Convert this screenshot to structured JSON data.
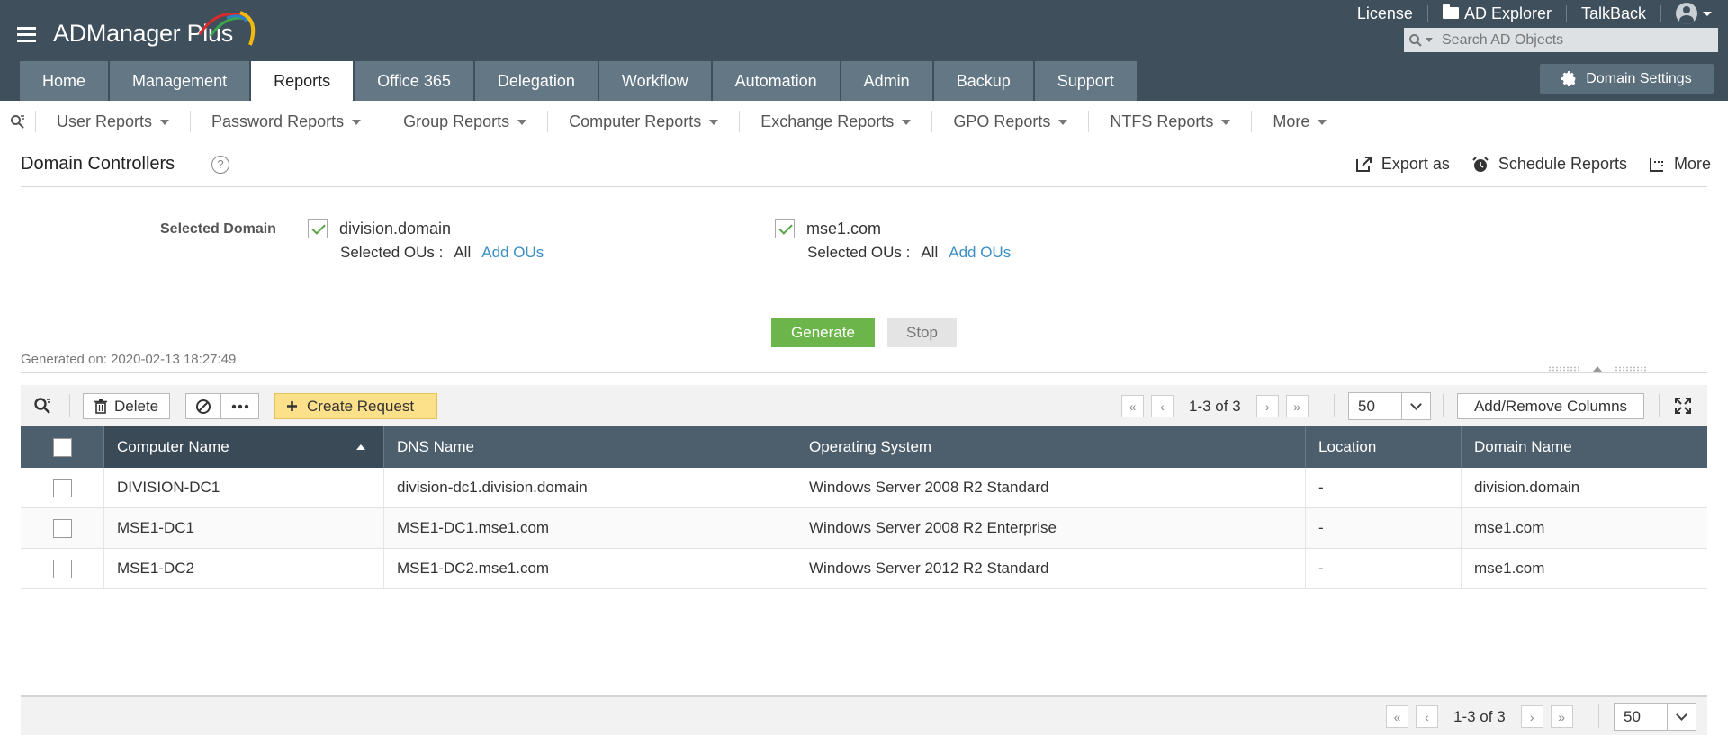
{
  "app": {
    "name": "ADManager Plus",
    "top_links": {
      "license": "License",
      "ad_explorer": "AD Explorer",
      "talkback": "TalkBack"
    },
    "search_placeholder": "Search AD Objects",
    "domain_settings": "Domain Settings",
    "colors": {
      "header": "#3f4f5c",
      "tab": "#637785",
      "accent_green": "#6cb54b",
      "link": "#3b8ec4",
      "create_btn": "#fde18a"
    }
  },
  "tabs": [
    {
      "label": "Home"
    },
    {
      "label": "Management"
    },
    {
      "label": "Reports",
      "active": true
    },
    {
      "label": "Office 365"
    },
    {
      "label": "Delegation"
    },
    {
      "label": "Workflow"
    },
    {
      "label": "Automation"
    },
    {
      "label": "Admin"
    },
    {
      "label": "Backup"
    },
    {
      "label": "Support"
    }
  ],
  "subnav": [
    {
      "label": "User Reports"
    },
    {
      "label": "Password Reports"
    },
    {
      "label": "Group Reports"
    },
    {
      "label": "Computer Reports"
    },
    {
      "label": "Exchange Reports"
    },
    {
      "label": "GPO Reports"
    },
    {
      "label": "NTFS Reports"
    },
    {
      "label": "More"
    }
  ],
  "page": {
    "title": "Domain Controllers",
    "help": "?",
    "actions": {
      "export": "Export as",
      "schedule": "Schedule Reports",
      "more": "More"
    }
  },
  "selection": {
    "label": "Selected Domain",
    "domains": [
      {
        "name": "division.domain",
        "checked": true,
        "ous_label": "Selected OUs :",
        "ous_value": "All",
        "add_ous": "Add OUs"
      },
      {
        "name": "mse1.com",
        "checked": true,
        "ous_label": "Selected OUs :",
        "ous_value": "All",
        "add_ous": "Add OUs"
      }
    ]
  },
  "buttons": {
    "generate": "Generate",
    "stop": "Stop"
  },
  "generated_on": "Generated on: 2020-02-13 18:27:49",
  "toolbar": {
    "delete": "Delete",
    "create_request": "Create Request",
    "page_info": "1-3 of 3",
    "per_page": "50",
    "add_remove_columns": "Add/Remove Columns"
  },
  "table": {
    "columns": [
      "Computer Name",
      "DNS Name",
      "Operating System",
      "Location",
      "Domain Name"
    ],
    "rows": [
      [
        "DIVISION-DC1",
        "division-dc1.division.domain",
        "Windows Server 2008 R2 Standard",
        "-",
        "division.domain"
      ],
      [
        "MSE1-DC1",
        "MSE1-DC1.mse1.com",
        "Windows Server 2008 R2 Enterprise",
        "-",
        "mse1.com"
      ],
      [
        "MSE1-DC2",
        "MSE1-DC2.mse1.com",
        "Windows Server 2012 R2 Standard",
        "-",
        "mse1.com"
      ]
    ]
  },
  "footer": {
    "page_info": "1-3 of 3",
    "per_page": "50"
  }
}
